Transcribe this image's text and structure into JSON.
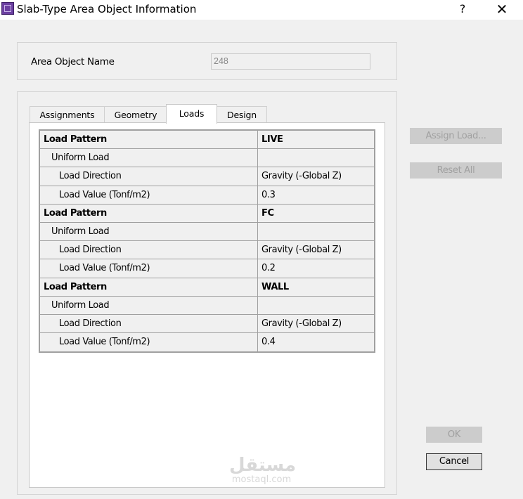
{
  "window": {
    "title": "Slab-Type Area Object Information",
    "help_glyph": "?",
    "close_glyph": "✕",
    "app_icon": "etabs-app-icon"
  },
  "area_object": {
    "label": "Area Object Name",
    "value": "248"
  },
  "tabs": [
    {
      "label": "Assignments",
      "active": false
    },
    {
      "label": "Geometry",
      "active": false
    },
    {
      "label": "Loads",
      "active": true
    },
    {
      "label": "Design",
      "active": false
    }
  ],
  "loads_table": [
    {
      "level": 0,
      "name": "Load Pattern",
      "value": "LIVE"
    },
    {
      "level": 1,
      "name": "Uniform Load",
      "value": ""
    },
    {
      "level": 2,
      "name": "Load Direction",
      "value": "Gravity (-Global Z)"
    },
    {
      "level": 2,
      "name": "Load Value  (Tonf/m2)",
      "value": "0.3"
    },
    {
      "level": 0,
      "name": "Load Pattern",
      "value": "FC"
    },
    {
      "level": 1,
      "name": "Uniform Load",
      "value": ""
    },
    {
      "level": 2,
      "name": "Load Direction",
      "value": "Gravity (-Global Z)"
    },
    {
      "level": 2,
      "name": "Load Value  (Tonf/m2)",
      "value": "0.2"
    },
    {
      "level": 0,
      "name": "Load Pattern",
      "value": "WALL"
    },
    {
      "level": 1,
      "name": "Uniform Load",
      "value": ""
    },
    {
      "level": 2,
      "name": "Load Direction",
      "value": "Gravity (-Global Z)"
    },
    {
      "level": 2,
      "name": "Load Value  (Tonf/m2)",
      "value": "0.4"
    }
  ],
  "buttons": {
    "assign_load": "Assign Load...",
    "reset_all": "Reset All",
    "ok": "OK",
    "cancel": "Cancel"
  },
  "watermark": {
    "arabic": "مستقل",
    "latin": "mostaql.com"
  }
}
